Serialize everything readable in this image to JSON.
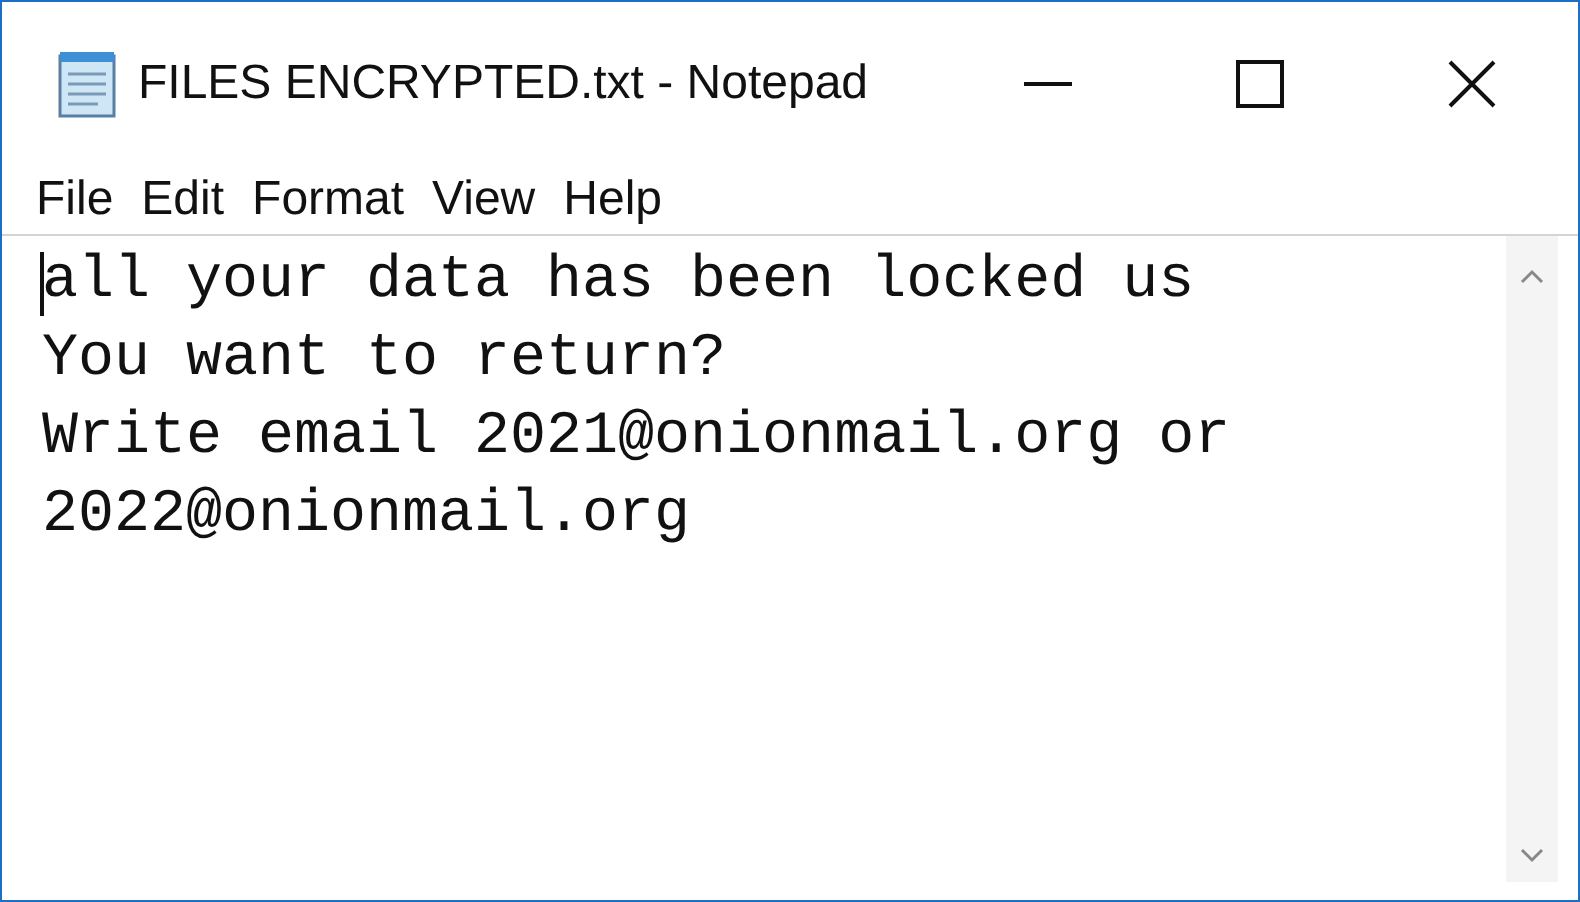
{
  "window": {
    "title": "FILES ENCRYPTED.txt - Notepad"
  },
  "menu": [
    "File",
    "Edit",
    "Format",
    "View",
    "Help"
  ],
  "document": {
    "lines": [
      "all your data has been locked us",
      "You want to return?",
      "Write email 2021@onionmail.org or",
      "2022@onionmail.org"
    ]
  }
}
